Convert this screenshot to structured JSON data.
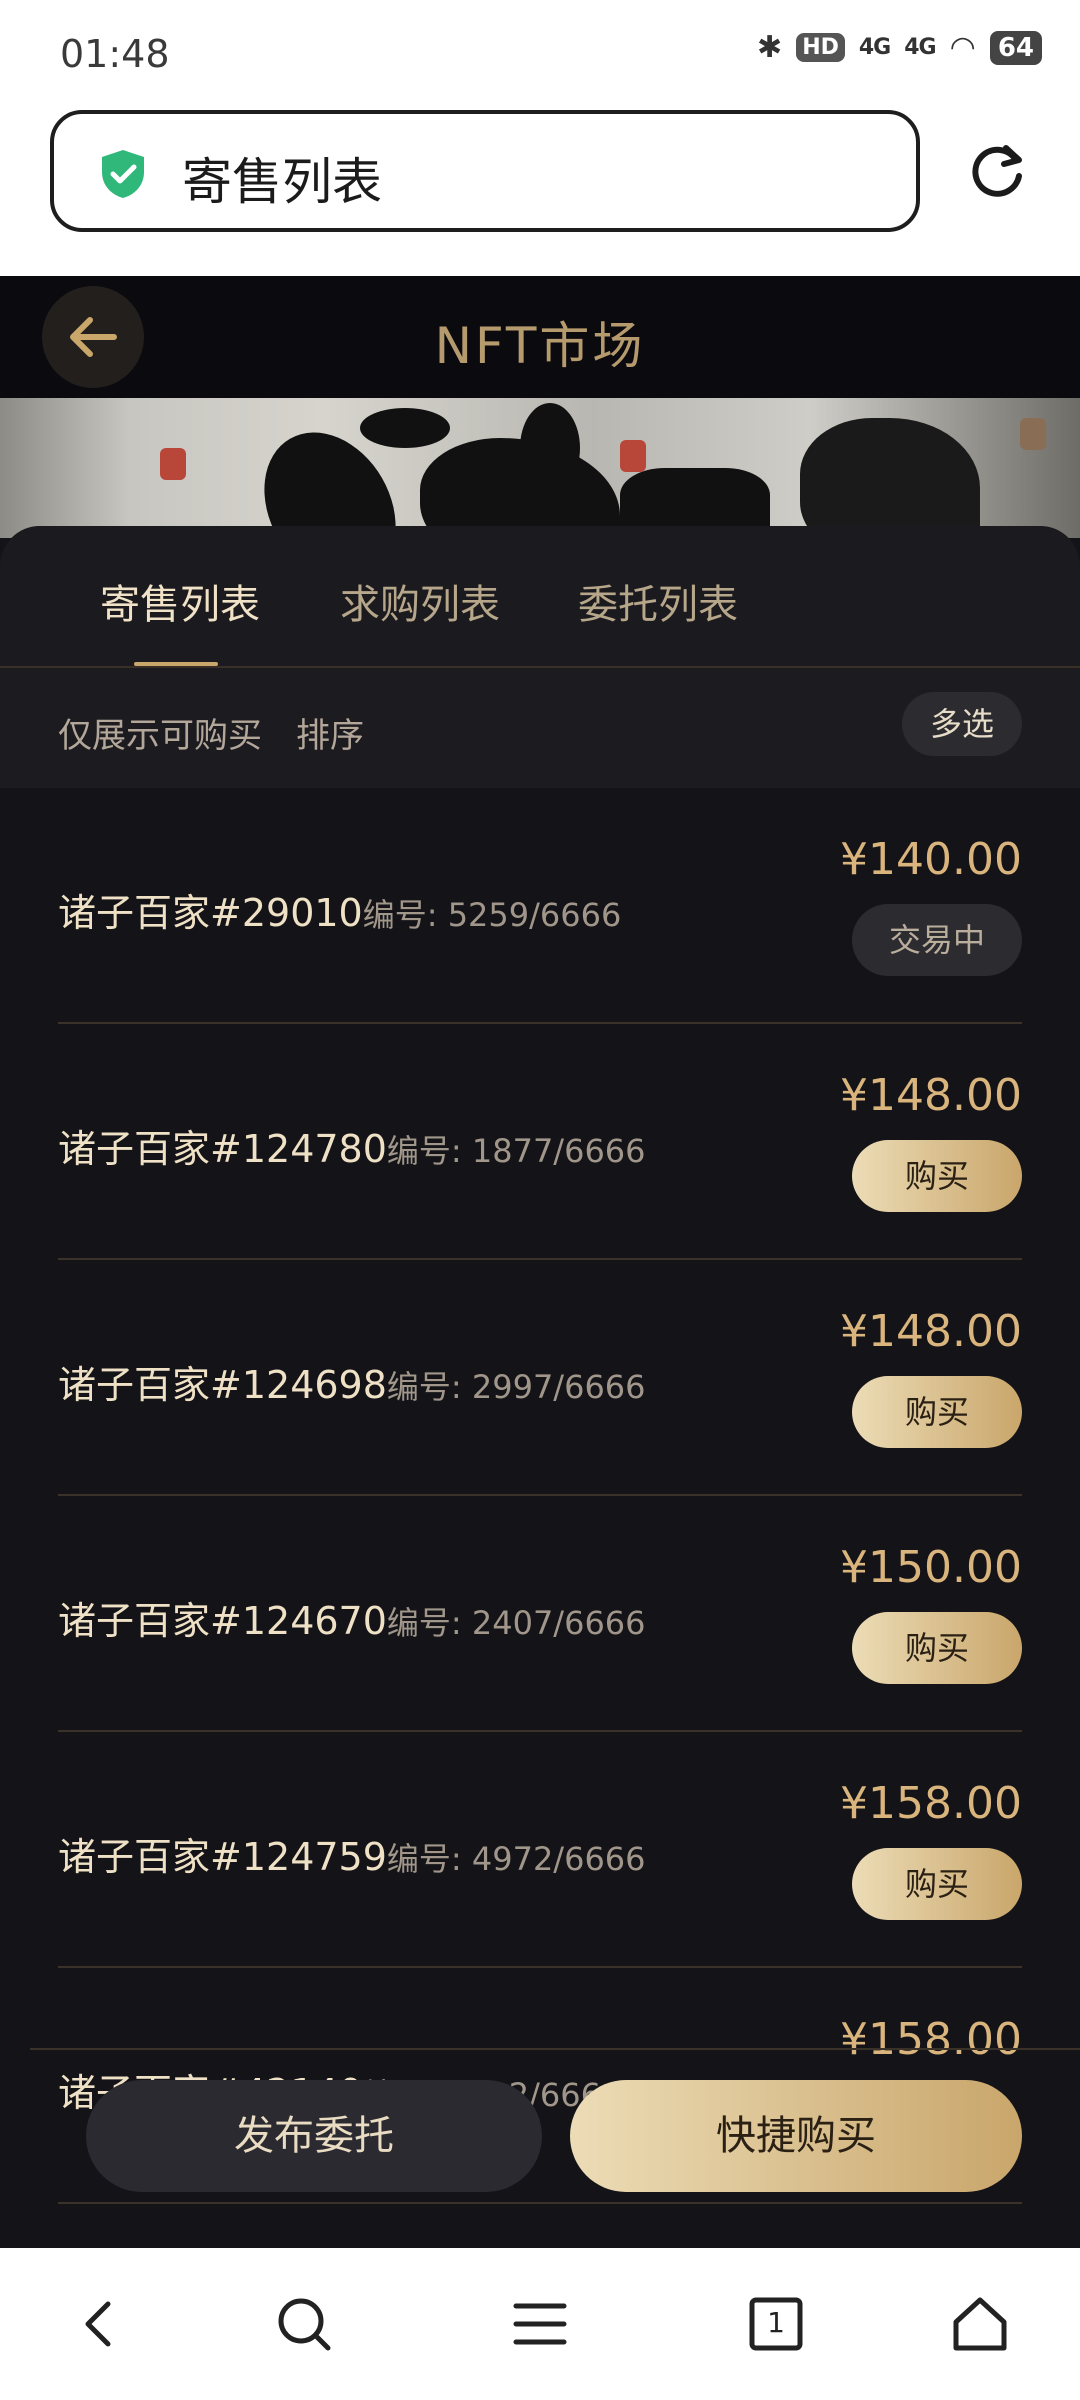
{
  "status_bar": {
    "time": "01:48",
    "signal_1": "4G",
    "signal_2": "4G",
    "hd_badge": "HD",
    "battery": "64"
  },
  "browser": {
    "url_title": "寄售列表"
  },
  "header": {
    "title": "NFT市场"
  },
  "tabs": [
    {
      "label": "寄售列表",
      "active": true
    },
    {
      "label": "求购列表",
      "active": false
    },
    {
      "label": "委托列表",
      "active": false
    }
  ],
  "filters": {
    "only_buyable": "仅展示可购买",
    "sort": "排序",
    "multi_select": "多选"
  },
  "listings": [
    {
      "name": "诸子百家#29010",
      "serial": "编号: 5259/6666",
      "price": "¥140.00",
      "action": "交易中"
    },
    {
      "name": "诸子百家#124780",
      "serial": "编号: 1877/6666",
      "price": "¥148.00",
      "action": "购买"
    },
    {
      "name": "诸子百家#124698",
      "serial": "编号: 2997/6666",
      "price": "¥148.00",
      "action": "购买"
    },
    {
      "name": "诸子百家#124670",
      "serial": "编号: 2407/6666",
      "price": "¥150.00",
      "action": "购买"
    },
    {
      "name": "诸子百家#124759",
      "serial": "编号: 4972/6666",
      "price": "¥158.00",
      "action": "购买"
    },
    {
      "name": "诸子百家#42140",
      "serial": "编号: 5722/6666",
      "price": "¥158.00",
      "action": ""
    }
  ],
  "bottom_actions": {
    "publish": "发布委托",
    "quick_buy": "快捷购买"
  },
  "nav": {
    "tabs_count": "1"
  },
  "colors": {
    "accent_gold": "#d9b47c",
    "background": "#141318",
    "shield_green": "#2fb879"
  }
}
